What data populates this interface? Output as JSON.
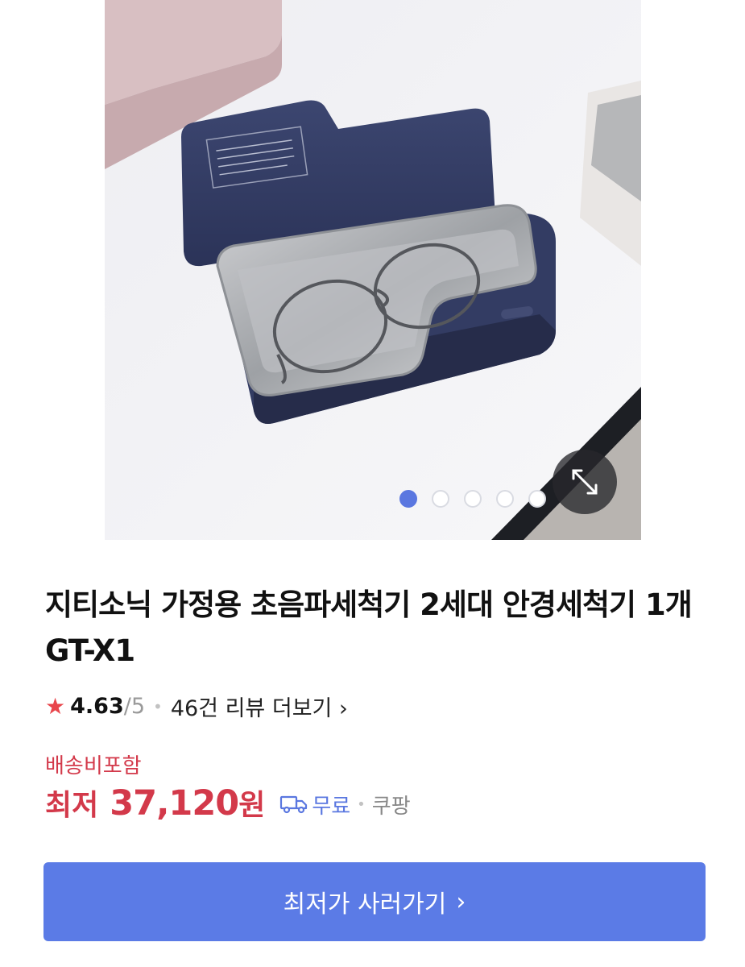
{
  "product": {
    "title": "지티소닉 가정용 초음파세척기 2세대 안경세척기 1개 GT-X1",
    "image_alt": "GT-X1 초음파세척기"
  },
  "gallery": {
    "total_images": 5,
    "current_index": 1,
    "expand_icon": "expand-icon"
  },
  "rating": {
    "score": "4.63",
    "max": "/5",
    "review_link": "46건 리뷰 더보기",
    "star_color": "#e8454b"
  },
  "pricing": {
    "shipping_note": "배송비포함",
    "label": "최저",
    "amount": "37,120",
    "currency": "원",
    "shipping": "무료",
    "seller": "쿠팡",
    "price_color": "#d3394a"
  },
  "cta": {
    "label": "최저가 사러가기",
    "chevron": "›",
    "color": "#5b7be6"
  }
}
